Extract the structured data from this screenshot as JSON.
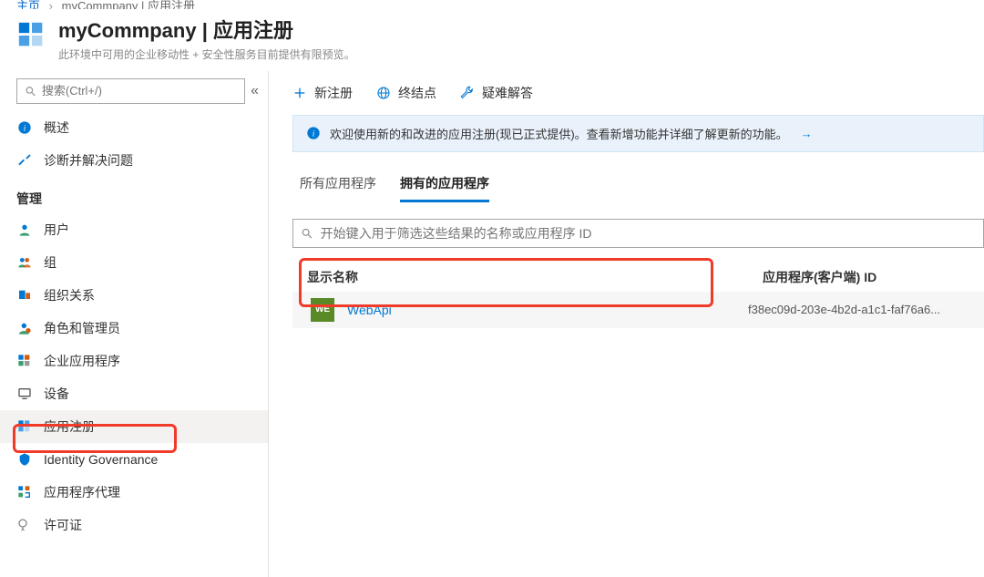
{
  "breadcrumb": {
    "root": "主页",
    "current": "myCommpany | 应用注册"
  },
  "header": {
    "title": "myCommpany | 应用注册",
    "subtitle": "此环境中可用的企业移动性 + 安全性服务目前提供有限预览。"
  },
  "sidebar": {
    "search_placeholder": "搜索(Ctrl+/)",
    "top_items": [
      {
        "label": "概述",
        "icon": "info"
      },
      {
        "label": "诊断并解决问题",
        "icon": "diagnose"
      }
    ],
    "group_label": "管理",
    "manage_items": [
      {
        "label": "用户",
        "icon": "user"
      },
      {
        "label": "组",
        "icon": "groups"
      },
      {
        "label": "组织关系",
        "icon": "orgrel"
      },
      {
        "label": "角色和管理员",
        "icon": "roles"
      },
      {
        "label": "企业应用程序",
        "icon": "apps"
      },
      {
        "label": "设备",
        "icon": "devices"
      },
      {
        "label": "应用注册",
        "icon": "appregs",
        "selected": true
      },
      {
        "label": "Identity Governance",
        "icon": "idgov"
      },
      {
        "label": "应用程序代理",
        "icon": "proxy"
      },
      {
        "label": "许可证",
        "icon": "licenses"
      }
    ]
  },
  "toolbar": {
    "new_reg": "新注册",
    "endpoints": "终结点",
    "troubleshoot": "疑难解答"
  },
  "banner": {
    "text": "欢迎使用新的和改进的应用注册(现已正式提供)。查看新增功能并详细了解更新的功能。"
  },
  "tabs": {
    "all": "所有应用程序",
    "owned": "拥有的应用程序"
  },
  "filter_placeholder": "开始键入用于筛选这些结果的名称或应用程序 ID",
  "columns": {
    "name": "显示名称",
    "clientid": "应用程序(客户端) ID"
  },
  "rows": [
    {
      "badge": "WE",
      "name": "WebApi",
      "client_id": "f38ec09d-203e-4b2d-a1c1-faf76a6..."
    }
  ]
}
